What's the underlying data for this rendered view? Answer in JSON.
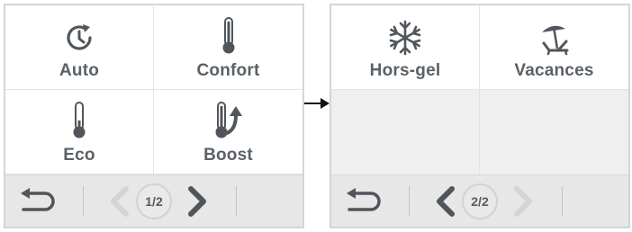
{
  "colors": {
    "icon": "#50565b",
    "chevron_active": "#4f555a",
    "chevron_inactive": "#d2d4d5",
    "footer_bg": "#e7e7e7",
    "panel_border": "#d3d5d6"
  },
  "screens": [
    {
      "modes": [
        {
          "label": "Auto",
          "icon": "clock-refresh-icon"
        },
        {
          "label": "Confort",
          "icon": "thermometer-icon"
        },
        {
          "label": "Eco",
          "icon": "thermometer-low-icon"
        },
        {
          "label": "Boost",
          "icon": "thermometer-boost-icon"
        }
      ],
      "footer": {
        "page_indicator": "1/2",
        "back_icon": "return-arrow-icon",
        "prev_enabled": false,
        "next_enabled": true
      }
    },
    {
      "modes": [
        {
          "label": "Hors-gel",
          "icon": "snowflake-icon"
        },
        {
          "label": "Vacances",
          "icon": "beach-lounger-icon"
        }
      ],
      "footer": {
        "page_indicator": "2/2",
        "back_icon": "return-arrow-icon",
        "prev_enabled": true,
        "next_enabled": false
      }
    }
  ],
  "transition_icon": "right-arrow-icon"
}
